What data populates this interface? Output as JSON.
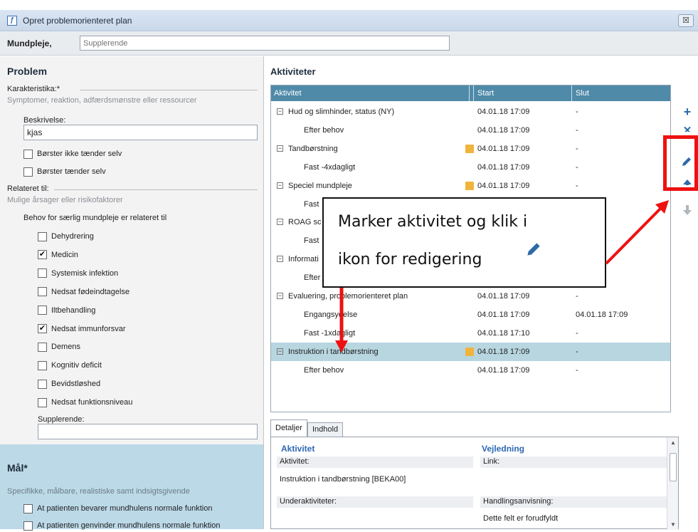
{
  "window": {
    "title": "Opret problemorienteret plan",
    "close_glyph": "☒"
  },
  "header": {
    "label": "Mundpleje,",
    "supplement_placeholder": "Supplerende"
  },
  "problem": {
    "title": "Problem",
    "karakteristika_label": "Karakteristika:*",
    "karakteristika_hint": "Symptomer, reaktion, adfærdsmønstre eller ressourcer",
    "beskrivelse_label": "Beskrivelse:",
    "beskrivelse_value": "kjas",
    "checkboxes": [
      {
        "label": "Børster ikke tænder selv",
        "checked": false
      },
      {
        "label": "Børster tænder selv",
        "checked": false
      }
    ],
    "relateret_label": "Relateret til:",
    "relateret_hint": "Mulige årsager eller risikofaktorer",
    "behov_label": "Behov for særlig mundpleje er relateret til",
    "factors": [
      {
        "label": "Dehydrering",
        "checked": false
      },
      {
        "label": "Medicin",
        "checked": true
      },
      {
        "label": "Systemisk infektion",
        "checked": false
      },
      {
        "label": "Nedsat fødeindtagelse",
        "checked": false
      },
      {
        "label": "Iltbehandling",
        "checked": false
      },
      {
        "label": "Nedsat immunforsvar",
        "checked": true
      },
      {
        "label": "Demens",
        "checked": false
      },
      {
        "label": "Kognitiv deficit",
        "checked": false
      },
      {
        "label": "Bevidstløshed",
        "checked": false
      },
      {
        "label": "Nedsat funktionsniveau",
        "checked": false
      }
    ],
    "supplerende_label": "Supplerende:"
  },
  "mal": {
    "title": "Mål*",
    "hint": "Specifikke, målbare, realistiske samt indsigtsgivende",
    "goals": [
      {
        "label": "At patienten bevarer mundhulens normale funktion",
        "checked": false
      },
      {
        "label": "At patienten genvinder mundhulens normale funktion",
        "checked": false
      }
    ]
  },
  "aktiviteter": {
    "title": "Aktiviteter",
    "columns": [
      "Aktivitet",
      "Start",
      "Slut"
    ],
    "rows": [
      {
        "name": "Hud og slimhinder, status (NY)",
        "start": "04.01.18 17:09",
        "slut": "-",
        "parent": true,
        "note": false
      },
      {
        "name": "Efter behov",
        "start": "04.01.18 17:09",
        "slut": "-",
        "parent": false,
        "note": false
      },
      {
        "name": "Tandbørstning",
        "start": "04.01.18 17:09",
        "slut": "-",
        "parent": true,
        "note": true
      },
      {
        "name": "Fast -4xdagligt",
        "start": "04.01.18 17:09",
        "slut": "-",
        "parent": false,
        "note": false
      },
      {
        "name": "Speciel mundpleje",
        "start": "04.01.18 17:09",
        "slut": "-",
        "parent": true,
        "note": true
      },
      {
        "name": "Fast",
        "start": "",
        "slut": "",
        "parent": false,
        "note": false
      },
      {
        "name": "ROAG sc",
        "start": "",
        "slut": "",
        "parent": true,
        "note": false
      },
      {
        "name": "Fast",
        "start": "",
        "slut": "",
        "parent": false,
        "note": false
      },
      {
        "name": "Informati",
        "start": "",
        "slut": "",
        "parent": true,
        "note": false
      },
      {
        "name": "Efter",
        "start": "",
        "slut": "",
        "parent": false,
        "note": false
      },
      {
        "name": "Evaluering, problemorienteret plan",
        "start": "04.01.18 17:09",
        "slut": "-",
        "parent": true,
        "note": false
      },
      {
        "name": "Engangsydelse",
        "start": "04.01.18 17:09",
        "slut": "04.01.18 17:09",
        "parent": false,
        "note": false
      },
      {
        "name": "Fast -1xdagligt",
        "start": "04.01.18 17:10",
        "slut": "-",
        "parent": false,
        "note": false
      },
      {
        "name": "Instruktion i tandbørstning",
        "start": "04.01.18 17:09",
        "slut": "-",
        "parent": true,
        "note": true,
        "selected": true
      },
      {
        "name": "Efter behov",
        "start": "04.01.18 17:09",
        "slut": "-",
        "parent": false,
        "note": false
      }
    ],
    "toggle_glyph": "−",
    "side_icons": [
      "plus-icon",
      "close-icon",
      "pencil-icon",
      "arrow-up-icon",
      "arrow-down-icon"
    ]
  },
  "details": {
    "tabs": [
      "Detaljer",
      "Indhold"
    ],
    "aktivitet_header": "Aktivitet",
    "vejledning_header": "Vejledning",
    "aktivitet_label": "Aktivitet:",
    "link_label": "Link:",
    "aktivitet_value": "Instruktion i tandbørstning [BEKA00]",
    "underaktiviteter_label": "Underaktiviteter:",
    "handling_label": "Handlingsanvisning:",
    "handling_value": "Dette felt er forudfyldt"
  },
  "callout": {
    "line1": "Marker aktivitet og klik i",
    "line2": "ikon for redigering"
  },
  "colors": {
    "grid_header": "#4f8aa8",
    "selected_row": "#b7d6e0",
    "accent_blue": "#2d67b3",
    "highlight_red": "#ee1111",
    "mal_background": "#bcd9e8"
  }
}
